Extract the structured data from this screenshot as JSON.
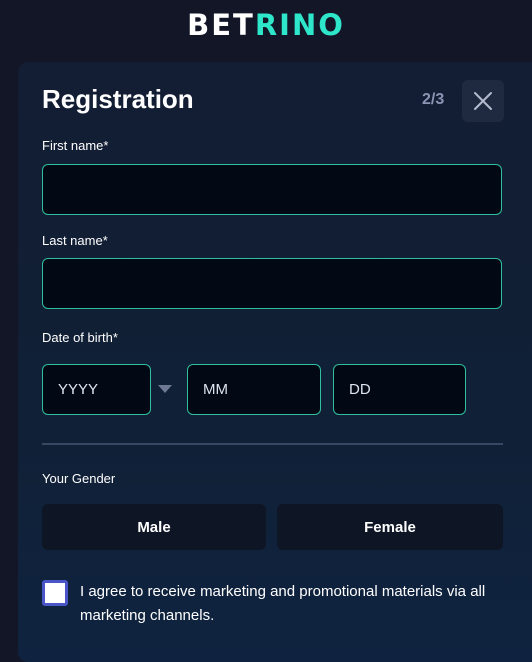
{
  "brand": {
    "logo_part1": "BET",
    "logo_part2": "RINO",
    "accent": "#2ee6c9"
  },
  "modal": {
    "title": "Registration",
    "step": "2/3",
    "close_icon": "close-icon"
  },
  "form": {
    "first_name": {
      "label": "First name*",
      "value": "",
      "placeholder": ""
    },
    "last_name": {
      "label": "Last name*",
      "value": "",
      "placeholder": ""
    },
    "dob": {
      "label": "Date of birth*",
      "year_placeholder": "YYYY",
      "month_placeholder": "MM",
      "day_placeholder": "DD"
    },
    "gender": {
      "label": "Your Gender",
      "options": [
        "Male",
        "Female"
      ]
    },
    "consent": {
      "text": "I agree to receive marketing and promotional materials via all marketing channels.",
      "checked": false
    }
  },
  "colors": {
    "background": "#121626",
    "field_border": "#2fbf9f",
    "checkbox_border": "#4a55c8"
  }
}
